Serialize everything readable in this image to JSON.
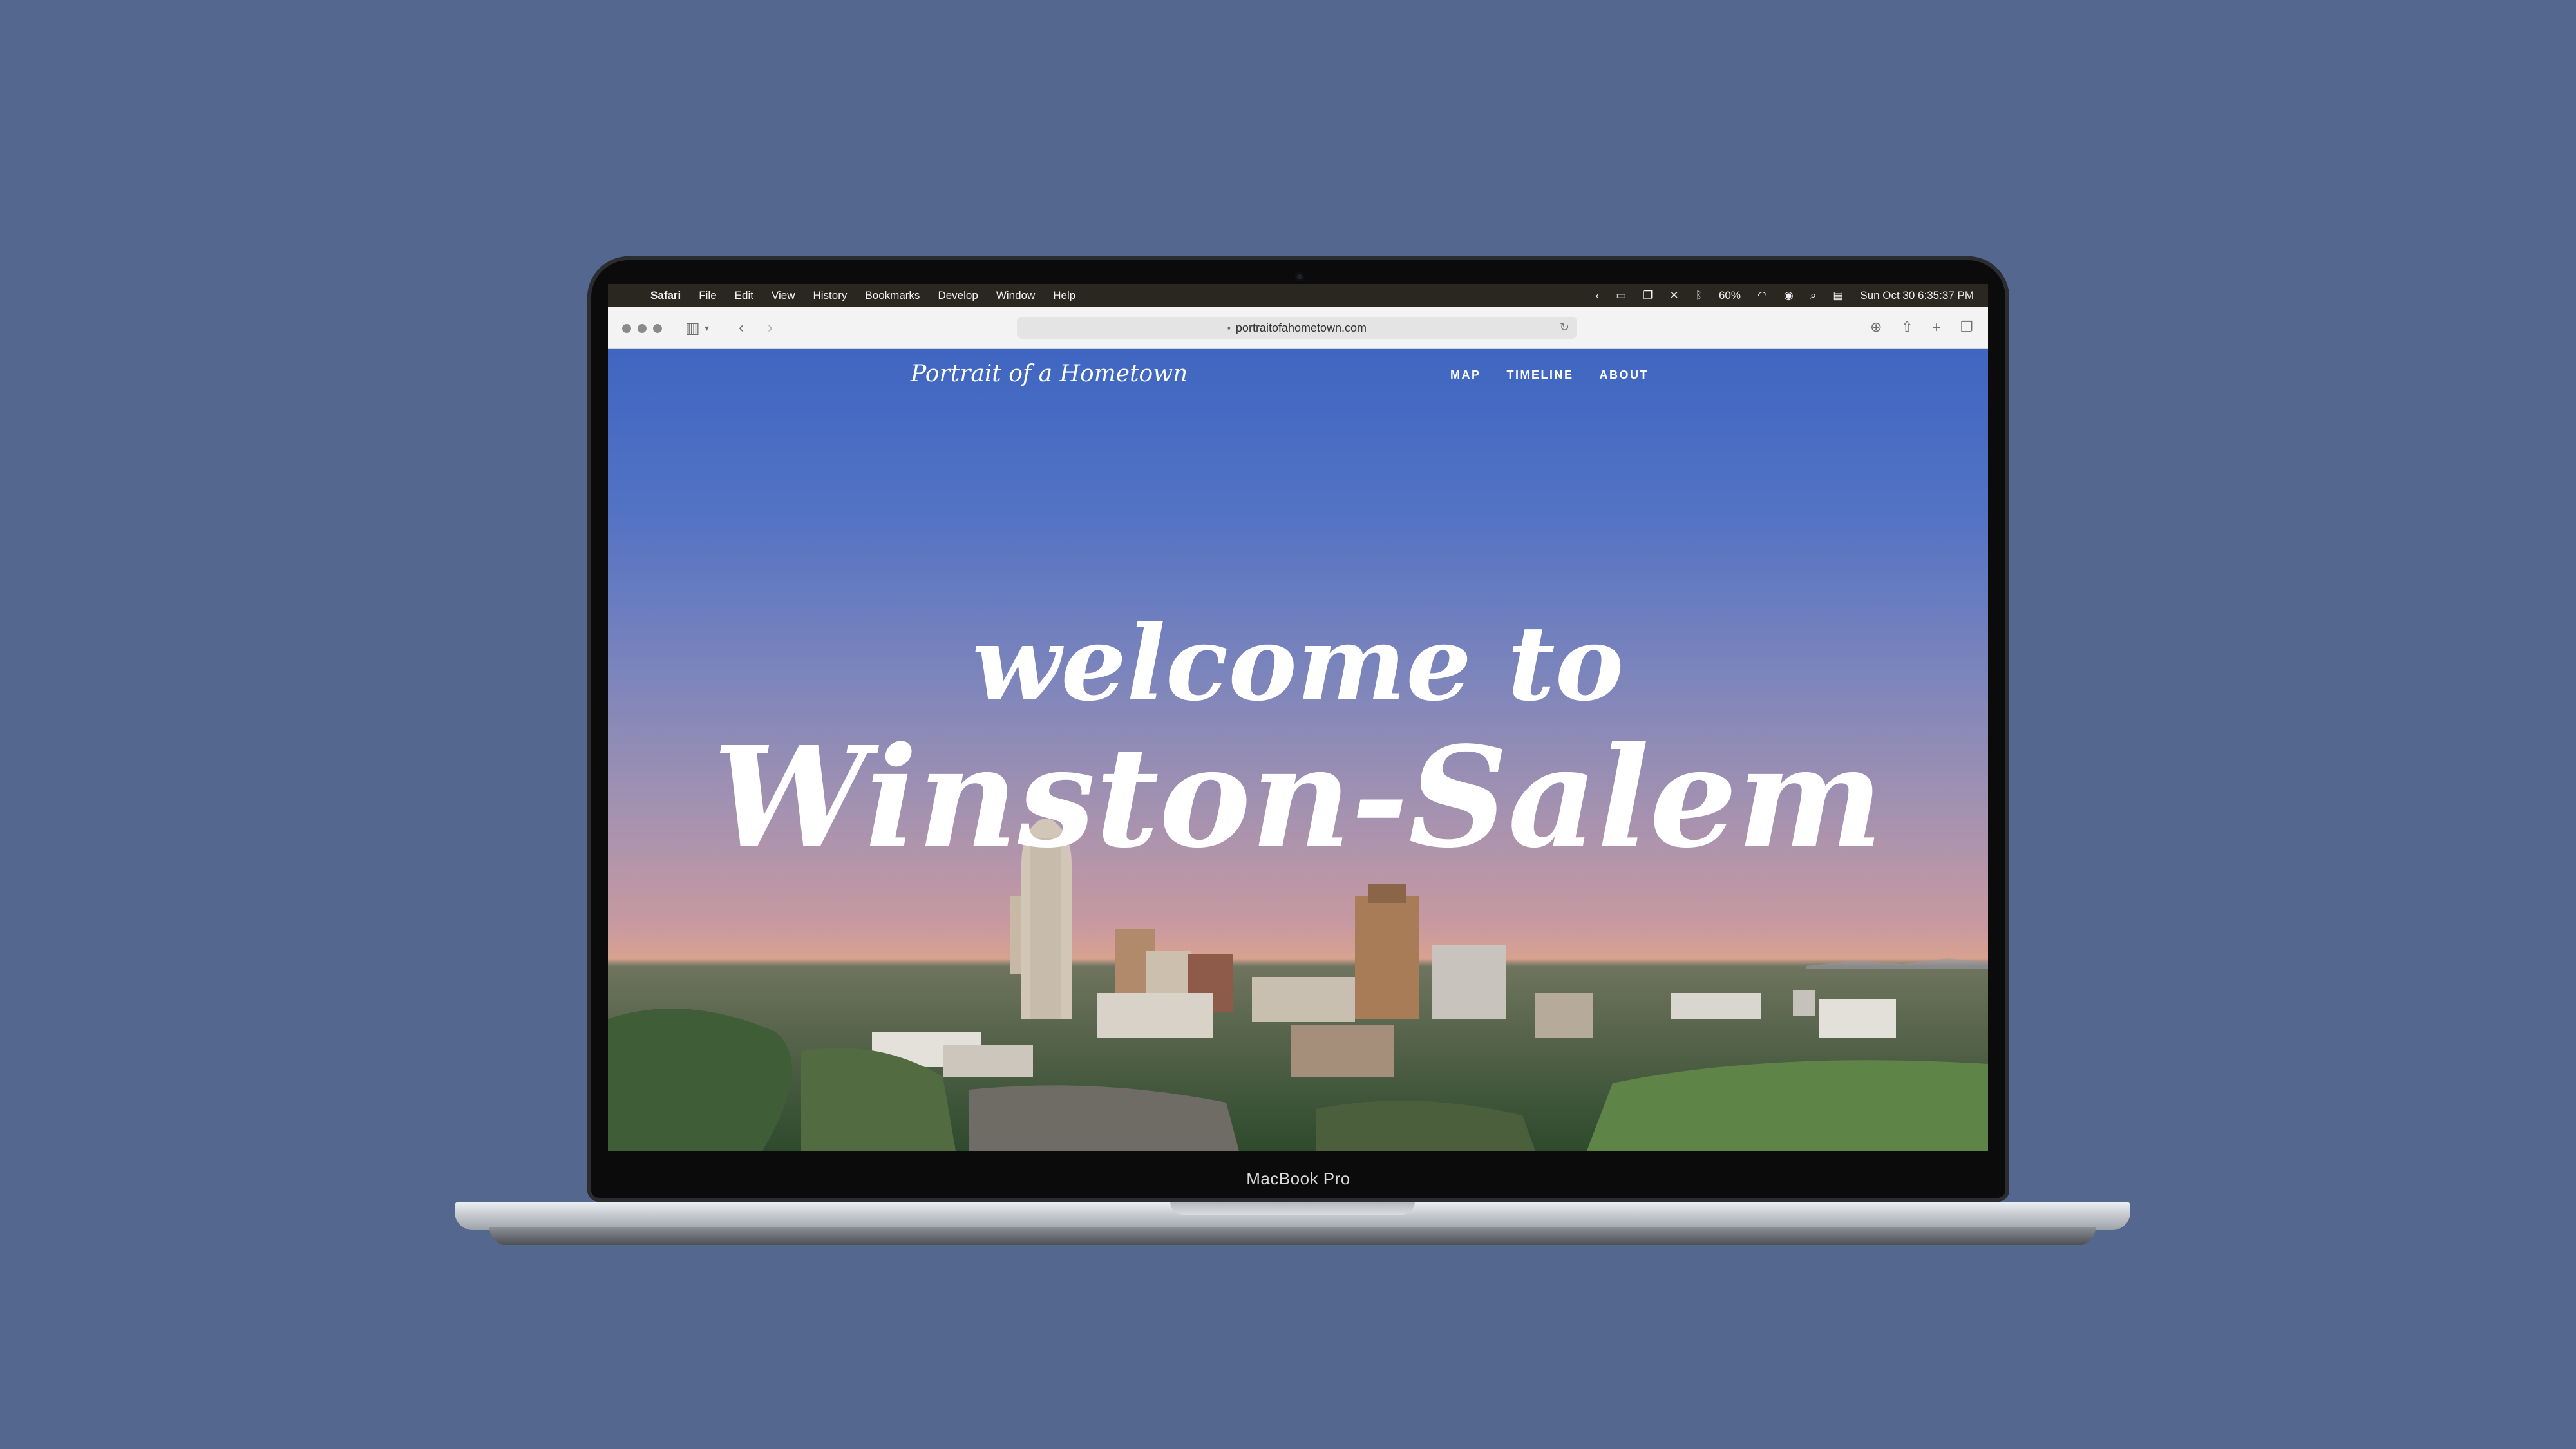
{
  "menubar": {
    "items": [
      "Safari",
      "File",
      "Edit",
      "View",
      "History",
      "Bookmarks",
      "Develop",
      "Window",
      "Help"
    ],
    "battery": "60%",
    "clock": "Sun Oct 30  6:35:37 PM"
  },
  "browser": {
    "url": "portraitofahometown.com"
  },
  "site": {
    "logo": "Portrait of a Hometown",
    "nav": [
      "MAP",
      "TIMELINE",
      "ABOUT"
    ],
    "hero_line1": "welcome to",
    "hero_line2": "Winston-Salem"
  },
  "device": {
    "model_label": "MacBook Pro"
  },
  "colors": {
    "background": "#54678f",
    "sky_top": "#3f66c2",
    "sky_horizon": "#d9a28f"
  }
}
